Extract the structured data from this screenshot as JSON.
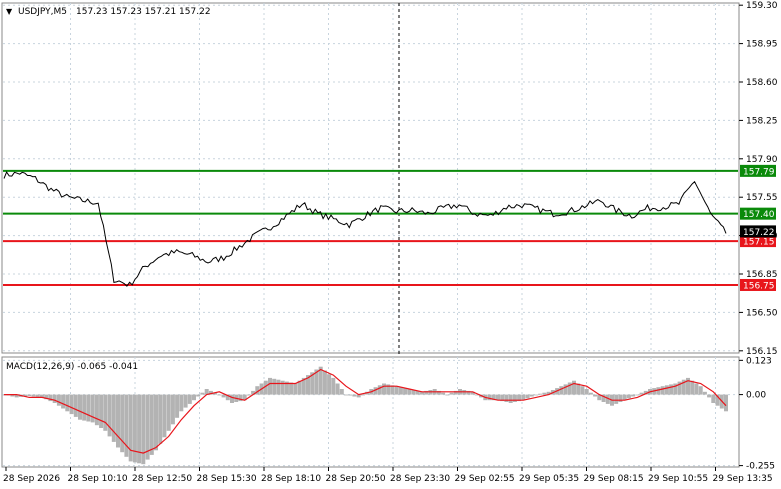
{
  "header": {
    "symbol": "USDJPY,M5",
    "ohlc": "157.23 157.23 157.21 157.22",
    "dropdown_icon": "triangle-down-icon"
  },
  "macd_panel": {
    "label": "MACD(12,26,9) -0.065 -0.041"
  },
  "colors": {
    "price_line": "#000000",
    "green_level": "#0a8a0a",
    "red_level": "#e8151b",
    "grid": "#c8d4de",
    "macd_histogram": "#b3b3b3",
    "macd_signal": "#e8151b",
    "current_price_label": "#000000"
  },
  "chart_data": [
    {
      "type": "line",
      "name": "price",
      "ylim": [
        156.13,
        159.32
      ],
      "yticks": [
        "159.30",
        "158.95",
        "158.60",
        "158.25",
        "157.90",
        "157.55",
        "157.20",
        "156.85",
        "156.50",
        "156.15"
      ],
      "current_price": "157.22",
      "levels": [
        {
          "value": 157.79,
          "label": "157.79",
          "color": "green"
        },
        {
          "value": 157.4,
          "label": "157.40",
          "color": "green"
        },
        {
          "value": 157.15,
          "label": "157.15",
          "color": "red"
        },
        {
          "value": 156.75,
          "label": "156.75",
          "color": "red"
        }
      ],
      "x": [
        "28 Sep 2026",
        "28 Sep 10:10",
        "28 Sep 12:50",
        "28 Sep 15:30",
        "28 Sep 18:10",
        "28 Sep 20:50",
        "28 Sep 23:30",
        "29 Sep 02:55",
        "29 Sep 05:35",
        "29 Sep 08:15",
        "29 Sep 10:55",
        "29 Sep 13:35"
      ],
      "values": [
        157.75,
        157.77,
        157.72,
        157.62,
        157.55,
        157.52,
        157.5,
        156.8,
        156.75,
        156.92,
        157.02,
        157.05,
        157.02,
        156.96,
        157.0,
        157.1,
        157.2,
        157.28,
        157.38,
        157.49,
        157.4,
        157.35,
        157.3,
        157.38,
        157.45,
        157.42,
        157.43,
        157.4,
        157.45,
        157.48,
        157.4,
        157.38,
        157.46,
        157.48,
        157.44,
        157.4,
        157.42,
        157.47,
        157.52,
        157.43,
        157.38,
        157.45,
        157.46,
        157.49,
        157.7,
        157.4,
        157.22
      ],
      "xticks": [
        "28 Sep 2026",
        "28 Sep 10:10",
        "28 Sep 12:50",
        "28 Sep 15:30",
        "28 Sep 18:10",
        "28 Sep 20:50",
        "28 Sep 23:30",
        "29 Sep 02:55",
        "29 Sep 05:35",
        "29 Sep 08:15",
        "29 Sep 10:55",
        "29 Sep 13:35"
      ],
      "vertical_marker": "28 Sep 23:30",
      "grid": true
    },
    {
      "type": "bar",
      "name": "MACD(12,26,9)",
      "ylim": [
        -0.26,
        0.135
      ],
      "yticks": [
        "0.123",
        "0.00",
        "-0.255"
      ],
      "histogram": [
        0.0,
        -0.01,
        -0.005,
        -0.01,
        -0.03,
        -0.06,
        -0.09,
        -0.1,
        -0.13,
        -0.19,
        -0.24,
        -0.25,
        -0.2,
        -0.13,
        -0.06,
        -0.02,
        0.02,
        0.0,
        -0.03,
        -0.02,
        0.03,
        0.06,
        0.05,
        0.04,
        0.07,
        0.1,
        0.06,
        0.0,
        -0.01,
        0.02,
        0.04,
        0.03,
        0.02,
        0.01,
        0.02,
        0.0,
        0.02,
        0.01,
        -0.02,
        -0.02,
        -0.03,
        -0.02,
        0.0,
        0.01,
        0.03,
        0.05,
        0.02,
        -0.02,
        -0.04,
        -0.02,
        0.0,
        0.02,
        0.03,
        0.04,
        0.06,
        0.03,
        -0.03,
        -0.06
      ],
      "signal": [
        0.0,
        0.0,
        -0.01,
        -0.01,
        -0.02,
        -0.04,
        -0.06,
        -0.08,
        -0.1,
        -0.15,
        -0.2,
        -0.21,
        -0.19,
        -0.15,
        -0.09,
        -0.04,
        0.0,
        0.01,
        -0.01,
        -0.02,
        0.01,
        0.04,
        0.04,
        0.04,
        0.06,
        0.09,
        0.07,
        0.03,
        0.0,
        0.01,
        0.03,
        0.03,
        0.02,
        0.01,
        0.01,
        0.01,
        0.01,
        0.01,
        -0.01,
        -0.02,
        -0.02,
        -0.02,
        -0.01,
        0.0,
        0.02,
        0.04,
        0.03,
        0.0,
        -0.02,
        -0.02,
        -0.01,
        0.01,
        0.02,
        0.03,
        0.05,
        0.04,
        0.01,
        -0.04
      ]
    }
  ]
}
